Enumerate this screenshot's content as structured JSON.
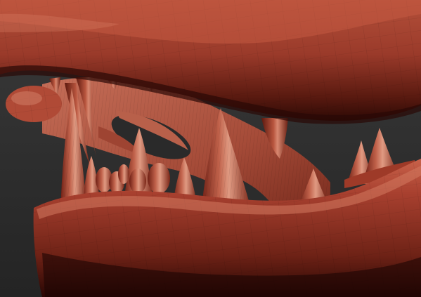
{
  "viewport": {
    "background_color": "#2e2e2e",
    "material_color": "#a8402f",
    "highlight_color": "#d98a72",
    "shadow_color": "#3a0c07"
  }
}
